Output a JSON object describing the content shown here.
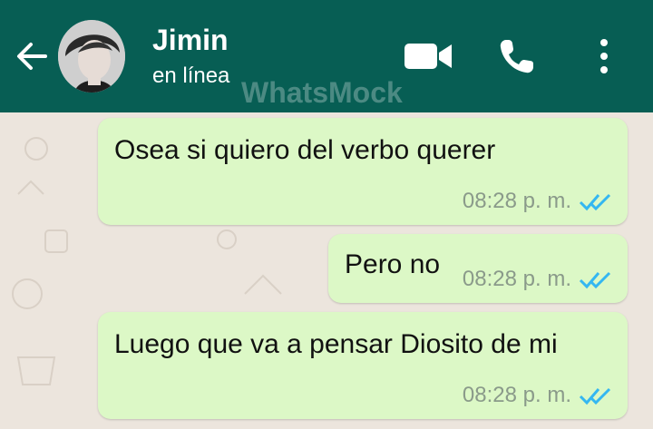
{
  "header": {
    "contact_name": "Jimin",
    "status": "en línea",
    "watermark": "WhatsMock",
    "colors": {
      "bar": "#075e54",
      "chat_bg": "#ece5dd",
      "bubble_out": "#dcf8c6",
      "ticks": "#34b7f1"
    },
    "icons": [
      "back-arrow-icon",
      "video-call-icon",
      "phone-icon",
      "more-vert-icon"
    ]
  },
  "messages": [
    {
      "text": "Osea si quiero del verbo querer",
      "time": "08:28 p. m.",
      "read": true
    },
    {
      "text": "Pero no",
      "time": "08:28 p. m.",
      "read": true
    },
    {
      "text": "Luego que va a pensar Diosito de mi",
      "time": "08:28 p. m.",
      "read": true
    }
  ]
}
